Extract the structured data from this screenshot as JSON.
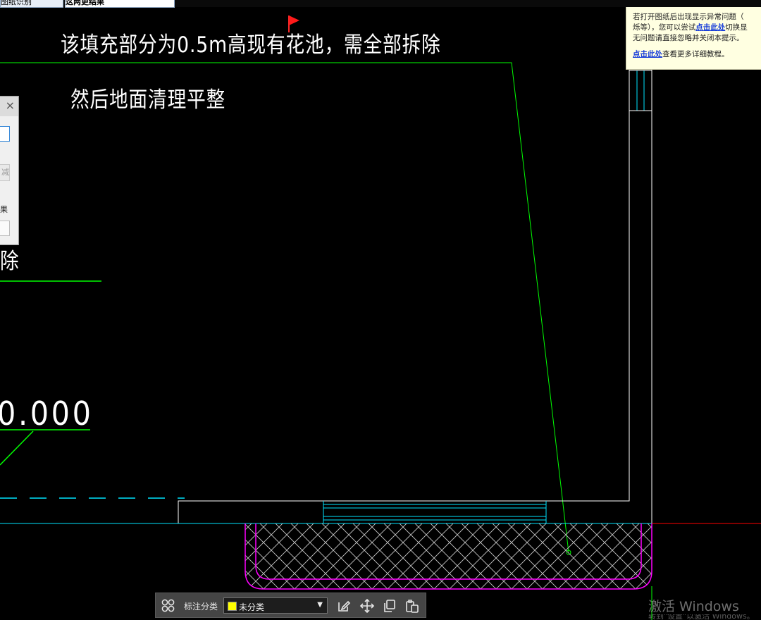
{
  "top_tabs": {
    "tab1": "图纸识别",
    "tab2": "这两更结果"
  },
  "annotations": {
    "line1": "该填充部分为0.5m高现有花池，需全部拆除",
    "line2": "然后地面清理平整",
    "line3": "除",
    "elevation": "0.000"
  },
  "dialog": {
    "close": "×",
    "faded": "减",
    "label": "果"
  },
  "notice": {
    "l1_pre": "若打开图纸后出现显示异常问题（",
    "l2_pre": "烁等），您可以尝试",
    "l2_link": "点击此处",
    "l2_post": "切换显",
    "l3": "无问题请直接忽略并关闭本提示。",
    "l4_link": "点击此处",
    "l4_post": "查看更多详细教程。"
  },
  "toolbar": {
    "label": "标注分类",
    "select_value": "未分类",
    "select_swatch_color": "#ffff00",
    "icons": [
      "grid-icon",
      "edit-icon",
      "move-icon",
      "copy-icon",
      "paste-icon"
    ]
  },
  "watermark": {
    "title": "激活 Windows",
    "sub": "转到\"设置\"以激活 Windows。"
  },
  "colors": {
    "background": "#000000",
    "green": "#00ff00",
    "white": "#ffffff",
    "cyan": "#00e5ff",
    "magenta": "#ff00ff",
    "red": "#ff0000",
    "hatch": "#c8c8c8"
  }
}
